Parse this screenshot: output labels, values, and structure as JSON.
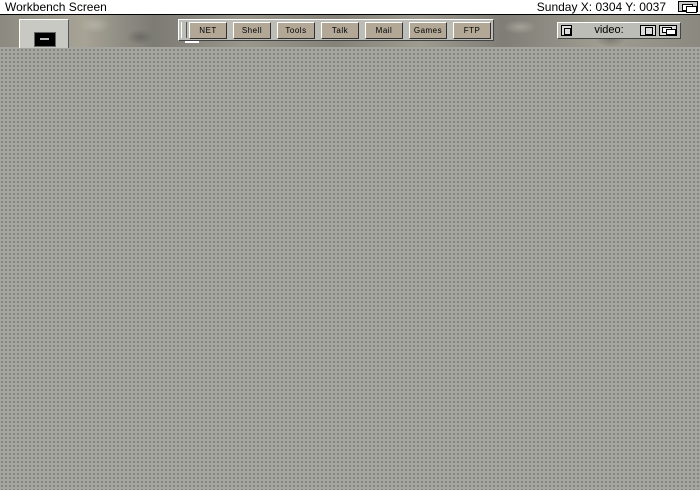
{
  "screen": {
    "title": "Workbench Screen",
    "clock": "Sunday  X: 0304 Y: 0037"
  },
  "dock": {
    "buttons": [
      "NET",
      "Shell",
      "Tools",
      "Talk",
      "Mail",
      "Games",
      "FTP"
    ]
  },
  "video_window": {
    "title": "video:"
  },
  "icons": {
    "drive": "monitor-drive-icon",
    "depth": "depth-arrange-icon",
    "close": "close-gadget-icon",
    "zoom": "zoom-gadget-icon"
  },
  "colors": {
    "background": "#a6a6a0",
    "titlebar": "#ffffff",
    "dock_button": "#b3a896"
  }
}
